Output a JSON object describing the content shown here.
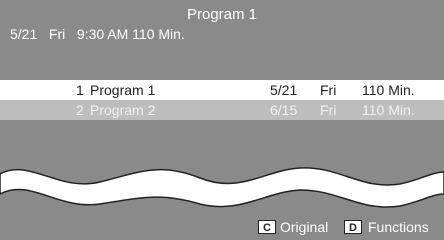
{
  "header": {
    "title": "Program 1",
    "info": "5/21   Fri   9:30 AM 110 Min."
  },
  "programs": [
    {
      "number": "1",
      "title": "Program 1",
      "date": "5/21",
      "day": "Fri",
      "duration": "110 Min.",
      "selected": true
    },
    {
      "number": "2",
      "title": "Program 2",
      "date": "6/15",
      "day": "Fri",
      "duration": "110 Min.",
      "selected": false
    }
  ],
  "footer": {
    "buttons": [
      {
        "key": "C",
        "label": "Original"
      },
      {
        "key": "D",
        "label": "Functions"
      }
    ]
  },
  "colors": {
    "background": "#8a8a8a",
    "selected_row": "#ffffff",
    "unselected_row": "#bdbdbd"
  }
}
